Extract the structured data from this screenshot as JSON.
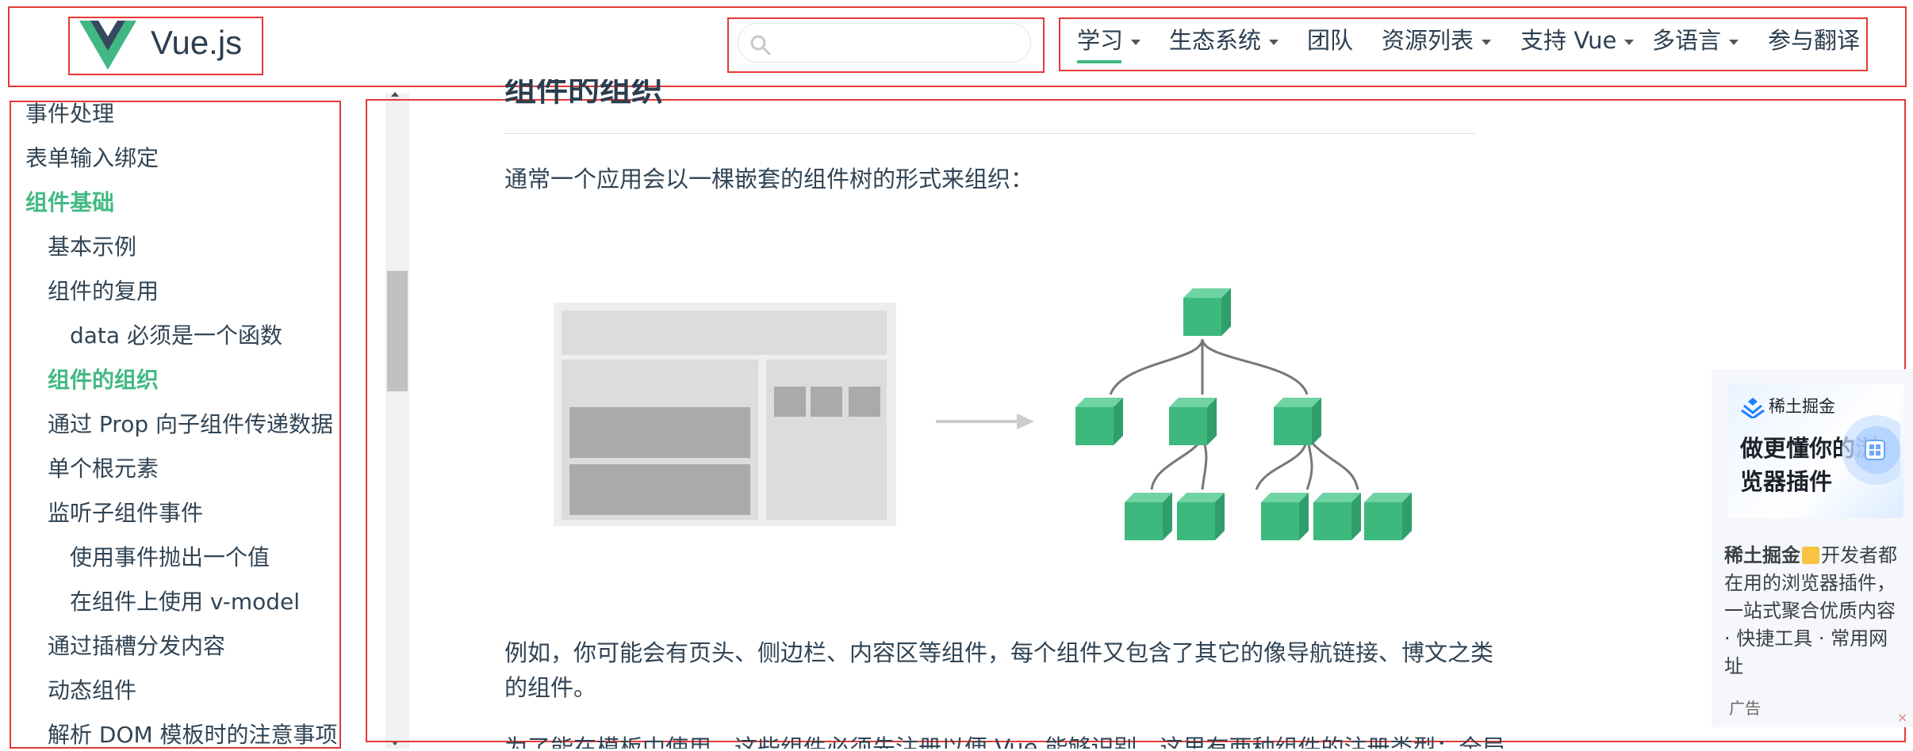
{
  "header": {
    "logo_text": "Vue.js",
    "search": {
      "placeholder": ""
    },
    "nav": [
      {
        "label": "学习",
        "has_dropdown": true,
        "active": true
      },
      {
        "label": "生态系统",
        "has_dropdown": true
      },
      {
        "label": "团队",
        "has_dropdown": false
      },
      {
        "label": "资源列表",
        "has_dropdown": true
      },
      {
        "label": "支持 Vue",
        "has_dropdown": true
      },
      {
        "label": "多语言",
        "has_dropdown": true
      },
      {
        "label": "参与翻译",
        "has_dropdown": false
      }
    ]
  },
  "sidebar": {
    "items": [
      {
        "label": "事件处理",
        "level": 0
      },
      {
        "label": "表单输入绑定",
        "level": 0
      },
      {
        "label": "组件基础",
        "level": 0,
        "active": true
      },
      {
        "label": "基本示例",
        "level": 1
      },
      {
        "label": "组件的复用",
        "level": 1
      },
      {
        "label": "data 必须是一个函数",
        "level": 2
      },
      {
        "label": "组件的组织",
        "level": 1,
        "active": true
      },
      {
        "label": "通过 Prop 向子组件传递数据",
        "level": 1
      },
      {
        "label": "单个根元素",
        "level": 1
      },
      {
        "label": "监听子组件事件",
        "level": 1
      },
      {
        "label": "使用事件抛出一个值",
        "level": 2
      },
      {
        "label": "在组件上使用 v-model",
        "level": 2
      },
      {
        "label": "通过插槽分发内容",
        "level": 1
      },
      {
        "label": "动态组件",
        "level": 1
      },
      {
        "label": "解析 DOM 模板时的注意事项",
        "level": 1
      }
    ]
  },
  "content": {
    "heading": "组件的组织",
    "intro": "通常一个应用会以一棵嵌套的组件树的形式来组织：",
    "example_line1": "例如，你可能会有页头、侧边栏、内容区等组件，每个组件又包含了其它的像导航链接、博文之类",
    "example_line2": "的组件。",
    "cut_line": "为了能在模板中使用，这些组件必须先注册以便 Vue 能够识别。这里有两种组件的注册类型：全局"
  },
  "ad": {
    "brand": "稀土掘金",
    "tagline": "做更懂你的浏览器插件",
    "description_brand": "稀土掘金",
    "description": "开发者都在用的浏览器插件，一站式聚合优质内容 · 快捷工具 · 常用网址",
    "label": "广告",
    "close": "×"
  },
  "colors": {
    "accent": "#42b983",
    "text": "#2c3e50",
    "highlight_border": "#e53935"
  }
}
